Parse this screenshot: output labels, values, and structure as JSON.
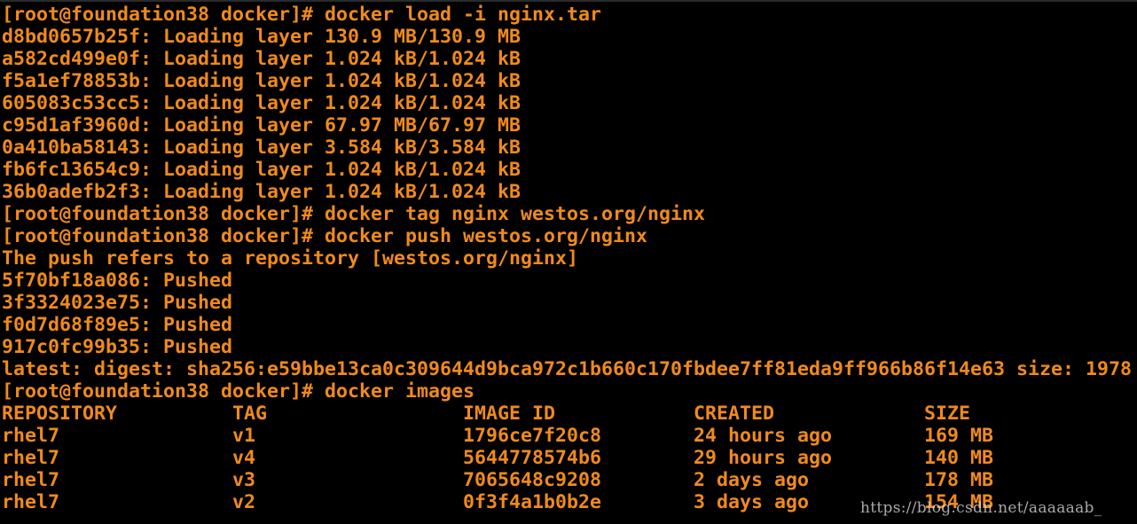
{
  "terminal": {
    "text_color": "#f08a1c",
    "background_color": "#000000",
    "lines": [
      "[root@foundation38 docker]# docker load -i nginx.tar",
      "d8bd0657b25f: Loading layer 130.9 MB/130.9 MB",
      "a582cd499e0f: Loading layer 1.024 kB/1.024 kB",
      "f5a1ef78853b: Loading layer 1.024 kB/1.024 kB",
      "605083c53cc5: Loading layer 1.024 kB/1.024 kB",
      "c95d1af3960d: Loading layer 67.97 MB/67.97 MB",
      "0a410ba58143: Loading layer 3.584 kB/3.584 kB",
      "fb6fc13654c9: Loading layer 1.024 kB/1.024 kB",
      "36b0adefb2f3: Loading layer 1.024 kB/1.024 kB",
      "[root@foundation38 docker]# docker tag nginx westos.org/nginx",
      "[root@foundation38 docker]# docker push westos.org/nginx",
      "The push refers to a repository [westos.org/nginx]",
      "5f70bf18a086: Pushed",
      "3f3324023e75: Pushed",
      "f0d7d68f89e5: Pushed",
      "917c0fc99b35: Pushed",
      "latest: digest: sha256:e59bbe13ca0c309644d9bca972c1b660c170fbdee7ff81eda9ff966b86f14e63 size: 1978",
      "[root@foundation38 docker]# docker images",
      "REPOSITORY          TAG                 IMAGE ID            CREATED             SIZE",
      "rhel7               v1                  1796ce7f20c8        24 hours ago        169 MB",
      "rhel7               v4                  5644778574b6        29 hours ago        140 MB",
      "rhel7               v3                  7065648c9208        2 days ago          178 MB",
      "rhel7               v2                  0f3f4a1b0b2e        3 days ago          154 MB"
    ]
  },
  "watermark": {
    "text": "https://blog.csdn.net/aaaaaab_"
  }
}
